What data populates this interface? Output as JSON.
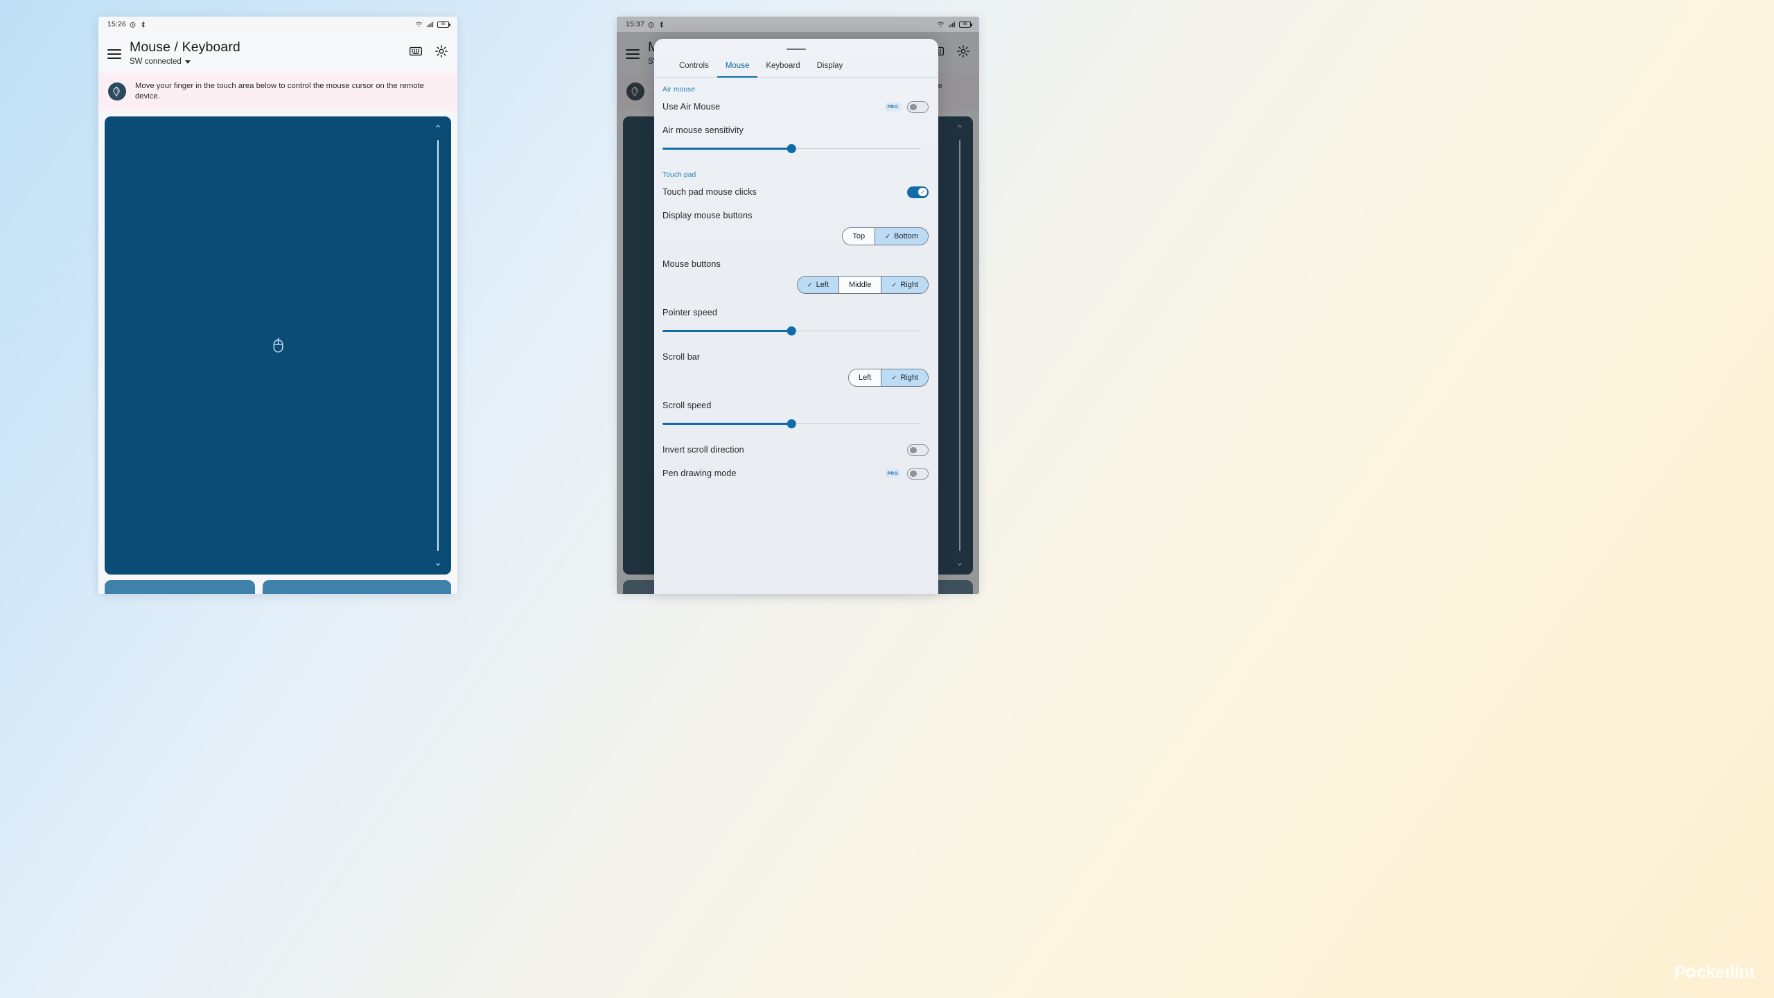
{
  "left_phone": {
    "status_bar": {
      "time": "15:26",
      "icons": [
        "alarm-icon",
        "bluetooth-icon",
        "wifi-icon",
        "signal-icon",
        "battery-icon"
      ],
      "battery_level": "66"
    },
    "app_bar": {
      "menu_icon": "hamburger-menu-icon",
      "title": "Mouse / Keyboard",
      "subtitle": "SW connected",
      "dropdown_icon": "caret-down-icon",
      "actions": [
        "keyboard-icon",
        "settings-gear-icon"
      ]
    },
    "banner": {
      "icon": "help-question-icon",
      "text": "Move your finger in the touch area below to control the mouse cursor on the remote device."
    },
    "touch_area": {
      "center_icon": "mouse-icon",
      "scroll_up_icon": "chevron-up-icon",
      "scroll_down_icon": "chevron-down-icon",
      "background_color": "#0b4c77"
    },
    "mouse_buttons": [
      {
        "name": "left-mouse-button"
      },
      {
        "name": "right-mouse-button"
      }
    ]
  },
  "right_phone": {
    "status_bar": {
      "time": "15:37",
      "icons": [
        "alarm-icon",
        "bluetooth-icon",
        "wifi-icon",
        "signal-icon",
        "battery-icon"
      ],
      "battery_level": "66"
    },
    "app_bar": {
      "title": "Mouse / Keyboard",
      "subtitle": "SW",
      "actions": [
        "keyboard-icon",
        "settings-gear-icon"
      ]
    }
  },
  "sheet": {
    "grabber": "drag-handle",
    "tabs": [
      {
        "label": "Controls",
        "active": false
      },
      {
        "label": "Mouse",
        "active": true
      },
      {
        "label": "Keyboard",
        "active": false
      },
      {
        "label": "Display",
        "active": false
      }
    ],
    "groups": [
      {
        "heading": "Air mouse",
        "rows": [
          {
            "type": "toggle",
            "label": "Use Air Mouse",
            "badge": "PRO",
            "value": "off"
          },
          {
            "type": "slider",
            "label": "Air mouse sensitivity",
            "percent": 50
          }
        ]
      },
      {
        "heading": "Touch pad",
        "rows": [
          {
            "type": "toggle",
            "label": "Touch pad mouse clicks",
            "value": "on"
          },
          {
            "type": "segmented",
            "label": "Display mouse buttons",
            "options": [
              {
                "label": "Top",
                "selected": false
              },
              {
                "label": "Bottom",
                "selected": true
              }
            ]
          },
          {
            "type": "segmented",
            "label": "Mouse buttons",
            "options": [
              {
                "label": "Left",
                "selected": true
              },
              {
                "label": "Middle",
                "selected": false
              },
              {
                "label": "Right",
                "selected": true
              }
            ]
          },
          {
            "type": "slider",
            "label": "Pointer speed",
            "percent": 50
          },
          {
            "type": "segmented",
            "label": "Scroll bar",
            "options": [
              {
                "label": "Left",
                "selected": false
              },
              {
                "label": "Right",
                "selected": true
              }
            ]
          },
          {
            "type": "slider",
            "label": "Scroll speed",
            "percent": 50
          },
          {
            "type": "toggle",
            "label": "Invert scroll direction",
            "value": "off"
          },
          {
            "type": "toggle",
            "label": "Pen drawing mode",
            "badge": "PRO",
            "value": "off"
          }
        ]
      }
    ]
  },
  "watermark": {
    "text_before": "P",
    "text_after": "cketlint"
  },
  "colors": {
    "accent": "#0f6ca8",
    "touchpad": "#0b4c77",
    "segment_selected": "#bcdcf5",
    "banner_bg": "#fbeff4"
  }
}
